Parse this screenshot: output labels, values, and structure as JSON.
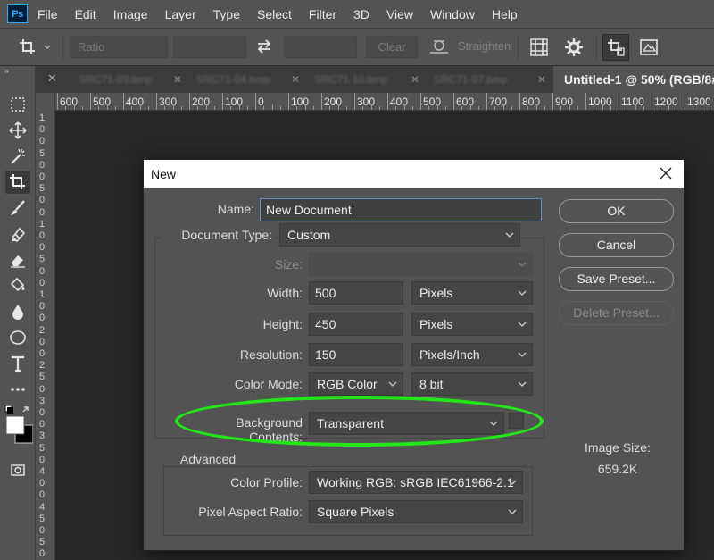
{
  "app": {
    "logo": "Ps"
  },
  "menubar": {
    "items": [
      "File",
      "Edit",
      "Image",
      "Layer",
      "Type",
      "Select",
      "Filter",
      "3D",
      "View",
      "Window",
      "Help"
    ]
  },
  "options_bar": {
    "ratio_placeholder": "Ratio",
    "clear_label": "Clear",
    "straighten_label": "Straighten"
  },
  "tabs": {
    "inactive": [
      "SRC71-03.bmp",
      "SRC71-04.bmp",
      "SRC71-10.bmp",
      "SRC71-07.bmp"
    ],
    "active": "Untitled-1 @ 50% (RGB/8#"
  },
  "ruler": {
    "h_labels": [
      "600",
      "500",
      "400",
      "300",
      "200",
      "100",
      "0",
      "100",
      "200",
      "300",
      "400",
      "500",
      "600",
      "700",
      "800",
      "900",
      "1000",
      "1100",
      "1200",
      "1300"
    ],
    "v_digits": [
      "1",
      "0",
      "0",
      "5",
      "0",
      "0",
      "5",
      "0",
      "0",
      "1",
      "0",
      "0",
      "5",
      "0",
      "0",
      "1",
      "0",
      "0",
      "2",
      "0",
      "0",
      "2",
      "5",
      "0",
      "3",
      "0",
      "0",
      "3",
      "5",
      "0",
      "4",
      "0",
      "0",
      "4",
      "5",
      "0",
      "5",
      "0",
      "0"
    ]
  },
  "dialog": {
    "title": "New",
    "name_label": "Name:",
    "name_value": "New Document",
    "doc_type_label": "Document Type:",
    "doc_type_value": "Custom",
    "size_label": "Size:",
    "size_value": "",
    "width_label": "Width:",
    "width_value": "500",
    "width_unit": "Pixels",
    "height_label": "Height:",
    "height_value": "450",
    "height_unit": "Pixels",
    "resolution_label": "Resolution:",
    "resolution_value": "150",
    "resolution_unit": "Pixels/Inch",
    "color_mode_label": "Color Mode:",
    "color_mode_value": "RGB Color",
    "bit_depth_value": "8 bit",
    "bg_contents_label": "Background Contents:",
    "bg_contents_value": "Transparent",
    "advanced_label": "Advanced",
    "color_profile_label": "Color Profile:",
    "color_profile_value": "Working RGB:  sRGB IEC61966-2.1",
    "pixel_aspect_label": "Pixel Aspect Ratio:",
    "pixel_aspect_value": "Square Pixels",
    "buttons": {
      "ok": "OK",
      "cancel": "Cancel",
      "save_preset": "Save Preset...",
      "delete_preset": "Delete Preset..."
    },
    "image_size_label": "Image Size:",
    "image_size_value": "659.2K"
  },
  "colors": {
    "highlight_ellipse": "#22e818",
    "ps_logo_blue": "#31a8ff"
  }
}
